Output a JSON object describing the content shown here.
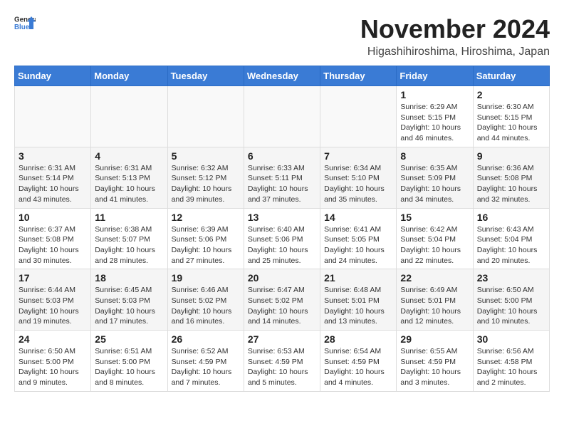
{
  "header": {
    "logo_general": "General",
    "logo_blue": "Blue",
    "month_year": "November 2024",
    "location": "Higashihiroshima, Hiroshima, Japan"
  },
  "weekdays": [
    "Sunday",
    "Monday",
    "Tuesday",
    "Wednesday",
    "Thursday",
    "Friday",
    "Saturday"
  ],
  "weeks": [
    [
      {
        "day": "",
        "info": ""
      },
      {
        "day": "",
        "info": ""
      },
      {
        "day": "",
        "info": ""
      },
      {
        "day": "",
        "info": ""
      },
      {
        "day": "",
        "info": ""
      },
      {
        "day": "1",
        "info": "Sunrise: 6:29 AM\nSunset: 5:15 PM\nDaylight: 10 hours\nand 46 minutes."
      },
      {
        "day": "2",
        "info": "Sunrise: 6:30 AM\nSunset: 5:15 PM\nDaylight: 10 hours\nand 44 minutes."
      }
    ],
    [
      {
        "day": "3",
        "info": "Sunrise: 6:31 AM\nSunset: 5:14 PM\nDaylight: 10 hours\nand 43 minutes."
      },
      {
        "day": "4",
        "info": "Sunrise: 6:31 AM\nSunset: 5:13 PM\nDaylight: 10 hours\nand 41 minutes."
      },
      {
        "day": "5",
        "info": "Sunrise: 6:32 AM\nSunset: 5:12 PM\nDaylight: 10 hours\nand 39 minutes."
      },
      {
        "day": "6",
        "info": "Sunrise: 6:33 AM\nSunset: 5:11 PM\nDaylight: 10 hours\nand 37 minutes."
      },
      {
        "day": "7",
        "info": "Sunrise: 6:34 AM\nSunset: 5:10 PM\nDaylight: 10 hours\nand 35 minutes."
      },
      {
        "day": "8",
        "info": "Sunrise: 6:35 AM\nSunset: 5:09 PM\nDaylight: 10 hours\nand 34 minutes."
      },
      {
        "day": "9",
        "info": "Sunrise: 6:36 AM\nSunset: 5:08 PM\nDaylight: 10 hours\nand 32 minutes."
      }
    ],
    [
      {
        "day": "10",
        "info": "Sunrise: 6:37 AM\nSunset: 5:08 PM\nDaylight: 10 hours\nand 30 minutes."
      },
      {
        "day": "11",
        "info": "Sunrise: 6:38 AM\nSunset: 5:07 PM\nDaylight: 10 hours\nand 28 minutes."
      },
      {
        "day": "12",
        "info": "Sunrise: 6:39 AM\nSunset: 5:06 PM\nDaylight: 10 hours\nand 27 minutes."
      },
      {
        "day": "13",
        "info": "Sunrise: 6:40 AM\nSunset: 5:06 PM\nDaylight: 10 hours\nand 25 minutes."
      },
      {
        "day": "14",
        "info": "Sunrise: 6:41 AM\nSunset: 5:05 PM\nDaylight: 10 hours\nand 24 minutes."
      },
      {
        "day": "15",
        "info": "Sunrise: 6:42 AM\nSunset: 5:04 PM\nDaylight: 10 hours\nand 22 minutes."
      },
      {
        "day": "16",
        "info": "Sunrise: 6:43 AM\nSunset: 5:04 PM\nDaylight: 10 hours\nand 20 minutes."
      }
    ],
    [
      {
        "day": "17",
        "info": "Sunrise: 6:44 AM\nSunset: 5:03 PM\nDaylight: 10 hours\nand 19 minutes."
      },
      {
        "day": "18",
        "info": "Sunrise: 6:45 AM\nSunset: 5:03 PM\nDaylight: 10 hours\nand 17 minutes."
      },
      {
        "day": "19",
        "info": "Sunrise: 6:46 AM\nSunset: 5:02 PM\nDaylight: 10 hours\nand 16 minutes."
      },
      {
        "day": "20",
        "info": "Sunrise: 6:47 AM\nSunset: 5:02 PM\nDaylight: 10 hours\nand 14 minutes."
      },
      {
        "day": "21",
        "info": "Sunrise: 6:48 AM\nSunset: 5:01 PM\nDaylight: 10 hours\nand 13 minutes."
      },
      {
        "day": "22",
        "info": "Sunrise: 6:49 AM\nSunset: 5:01 PM\nDaylight: 10 hours\nand 12 minutes."
      },
      {
        "day": "23",
        "info": "Sunrise: 6:50 AM\nSunset: 5:00 PM\nDaylight: 10 hours\nand 10 minutes."
      }
    ],
    [
      {
        "day": "24",
        "info": "Sunrise: 6:50 AM\nSunset: 5:00 PM\nDaylight: 10 hours\nand 9 minutes."
      },
      {
        "day": "25",
        "info": "Sunrise: 6:51 AM\nSunset: 5:00 PM\nDaylight: 10 hours\nand 8 minutes."
      },
      {
        "day": "26",
        "info": "Sunrise: 6:52 AM\nSunset: 4:59 PM\nDaylight: 10 hours\nand 7 minutes."
      },
      {
        "day": "27",
        "info": "Sunrise: 6:53 AM\nSunset: 4:59 PM\nDaylight: 10 hours\nand 5 minutes."
      },
      {
        "day": "28",
        "info": "Sunrise: 6:54 AM\nSunset: 4:59 PM\nDaylight: 10 hours\nand 4 minutes."
      },
      {
        "day": "29",
        "info": "Sunrise: 6:55 AM\nSunset: 4:59 PM\nDaylight: 10 hours\nand 3 minutes."
      },
      {
        "day": "30",
        "info": "Sunrise: 6:56 AM\nSunset: 4:58 PM\nDaylight: 10 hours\nand 2 minutes."
      }
    ]
  ]
}
